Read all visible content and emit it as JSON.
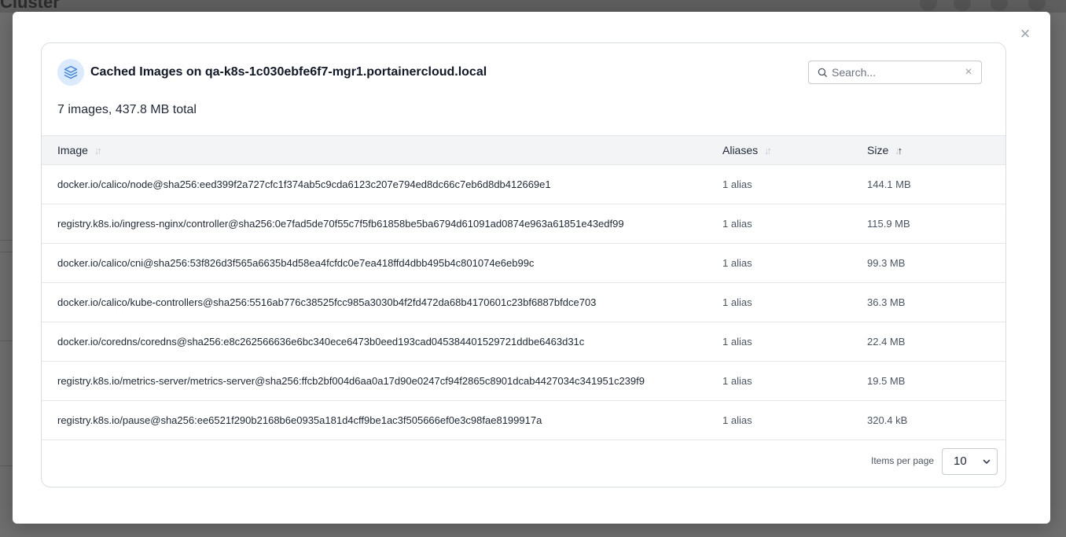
{
  "background": {
    "page_title": "Cluster"
  },
  "modal": {
    "close_label": "×",
    "title": "Cached Images on qa-k8s-1c030ebfe6f7-mgr1.portainercloud.local",
    "summary": "7 images, 437.8 MB total",
    "search": {
      "placeholder": "Search...",
      "value": "",
      "clear_label": "×"
    },
    "table": {
      "columns": [
        {
          "label": "Image",
          "sort": "none"
        },
        {
          "label": "Aliases",
          "sort": "none"
        },
        {
          "label": "Size",
          "sort": "ascending"
        }
      ],
      "rows": [
        {
          "image": "docker.io/calico/node@sha256:eed399f2a727cfc1f374ab5c9cda6123c207e794ed8dc66c7eb6d8db412669e1",
          "aliases": "1 alias",
          "size": "144.1 MB"
        },
        {
          "image": "registry.k8s.io/ingress-nginx/controller@sha256:0e7fad5de70f55c7f5fb61858be5ba6794d61091ad0874e963a61851e43edf99",
          "aliases": "1 alias",
          "size": "115.9 MB"
        },
        {
          "image": "docker.io/calico/cni@sha256:53f826d3f565a6635b4d58ea4fcfdc0e7ea418ffd4dbb495b4c801074e6eb99c",
          "aliases": "1 alias",
          "size": "99.3 MB"
        },
        {
          "image": "docker.io/calico/kube-controllers@sha256:5516ab776c38525fcc985a3030b4f2fd472da68b4170601c23bf6887bfdce703",
          "aliases": "1 alias",
          "size": "36.3 MB"
        },
        {
          "image": "docker.io/coredns/coredns@sha256:e8c262566636e6bc340ece6473b0eed193cad045384401529721ddbe6463d31c",
          "aliases": "1 alias",
          "size": "22.4 MB"
        },
        {
          "image": "registry.k8s.io/metrics-server/metrics-server@sha256:ffcb2bf004d6aa0a17d90e0247cf94f2865c8901dcab4427034c341951c239f9",
          "aliases": "1 alias",
          "size": "19.5 MB"
        },
        {
          "image": "registry.k8s.io/pause@sha256:ee6521f290b2168b6e0935a181d4cff9be1ac3f505666ef0e3c98fae8199917a",
          "aliases": "1 alias",
          "size": "320.4 kB"
        }
      ]
    },
    "pagination": {
      "items_per_page_label": "Items per page",
      "items_per_page_value": "10"
    }
  },
  "colors": {
    "accent": "#3b82f6",
    "icon_bg": "#dbeafe",
    "header_bg": "#f3f4f6",
    "border": "#e5e7eb"
  },
  "icons": {
    "header": "layers-icon",
    "search": "search-icon",
    "close": "close-icon",
    "chevron": "chevron-down-icon"
  }
}
